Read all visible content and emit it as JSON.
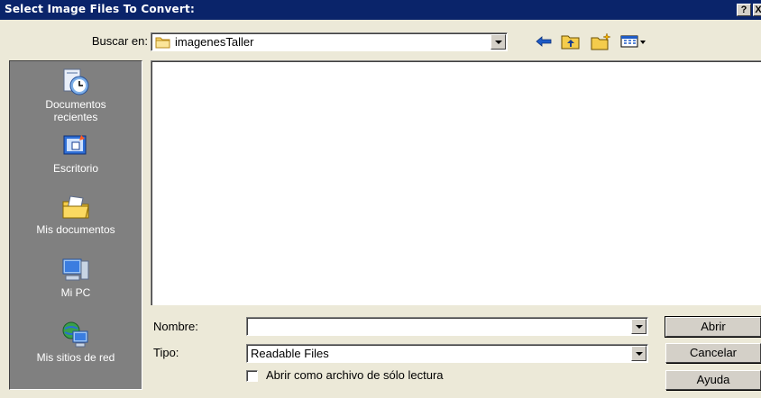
{
  "window": {
    "title": "Select Image Files To Convert:",
    "help_label": "?",
    "close_label": "X"
  },
  "lookin": {
    "label": "Buscar en:",
    "value": "imagenesTaller"
  },
  "toolbar": {
    "icons": [
      "back-arrow-icon",
      "up-folder-icon",
      "new-folder-icon",
      "view-menu-icon"
    ]
  },
  "places": [
    {
      "label": "Documentos\nrecientes",
      "icon": "recent-documents-icon"
    },
    {
      "label": "Escritorio",
      "icon": "desktop-icon"
    },
    {
      "label": "Mis documentos",
      "icon": "my-documents-icon"
    },
    {
      "label": "Mi PC",
      "icon": "my-computer-icon"
    },
    {
      "label": "Mis sitios de red",
      "icon": "network-places-icon"
    }
  ],
  "filename": {
    "label": "Nombre:",
    "value": ""
  },
  "filetype": {
    "label": "Tipo:",
    "value": "Readable Files"
  },
  "readonly": {
    "label": "Abrir como archivo de sólo lectura",
    "checked": false
  },
  "buttons": {
    "open": "Abrir",
    "cancel": "Cancelar",
    "help": "Ayuda"
  },
  "colors": {
    "titlebar": "#0a246a",
    "face": "#ece9d8",
    "places_bg": "#808080"
  }
}
